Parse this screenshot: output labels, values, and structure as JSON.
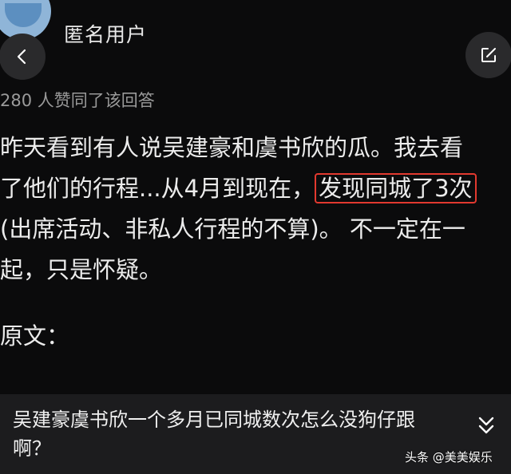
{
  "header": {
    "username": "匿名用户",
    "likes_text": "280 人赞同了该回答"
  },
  "answer": {
    "lines": [
      "昨天看到有人说吴建豪和虞书欣的瓜。我去看",
      "了他们的行程...从4月到现在，",
      "(出席活动、非私人行程的不算)。 不一定在一",
      "起，只是怀疑。"
    ],
    "highlighted": "发现同城了3次",
    "original_label": "原文："
  },
  "quote": {
    "line1": "吴建豪虞书欣一个多月已同城数次怎么没狗仔跟",
    "line2": "啊？"
  },
  "watermark": "头条 @美美娱乐",
  "icons": {
    "back": "chevron-left-icon",
    "share": "share-icon",
    "expand": "double-chevron-down-icon"
  },
  "colors": {
    "background": "#0b0b0c",
    "highlight_border": "#e2392f",
    "quote_background": "#1c1c1e"
  }
}
